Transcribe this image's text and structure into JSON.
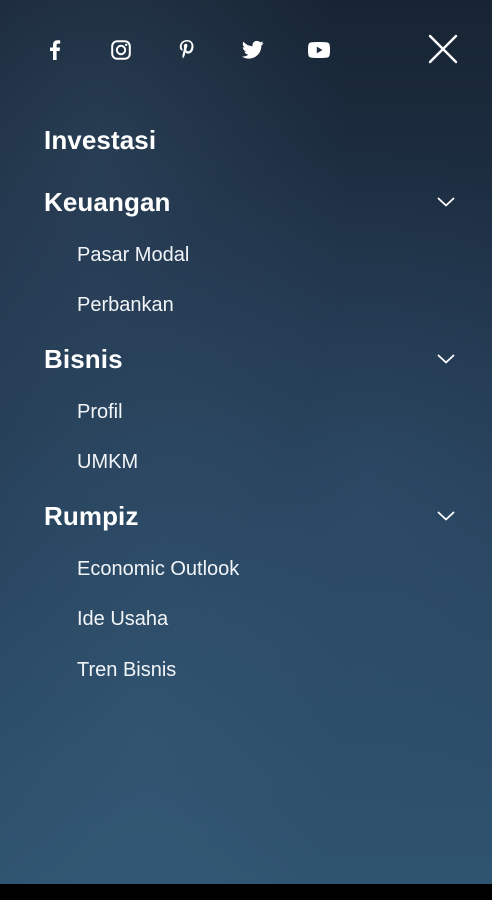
{
  "social": [
    {
      "icon": "facebook-icon"
    },
    {
      "icon": "instagram-icon"
    },
    {
      "icon": "pinterest-icon"
    },
    {
      "icon": "twitter-icon"
    },
    {
      "icon": "youtube-icon"
    }
  ],
  "close": {
    "icon": "close-icon"
  },
  "menu": {
    "categories": [
      {
        "label": "Investasi",
        "expandable": false,
        "items": []
      },
      {
        "label": "Keuangan",
        "expandable": true,
        "items": [
          "Pasar Modal",
          "Perbankan"
        ]
      },
      {
        "label": "Bisnis",
        "expandable": true,
        "items": [
          "Profil",
          "UMKM"
        ]
      },
      {
        "label": "Rumpiz",
        "expandable": true,
        "items": [
          "Economic Outlook",
          "Ide Usaha",
          "Tren Bisnis"
        ]
      }
    ]
  },
  "colors": {
    "text": "#ffffff",
    "background_top": "#172433",
    "background_bottom": "#2f5470"
  }
}
